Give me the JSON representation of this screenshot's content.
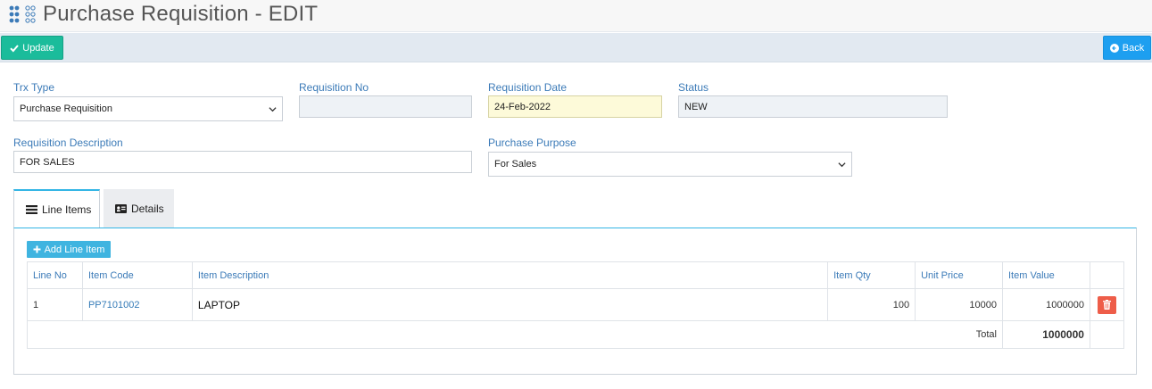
{
  "page": {
    "title": "Purchase Requisition - EDIT"
  },
  "toolbar": {
    "update_label": "Update",
    "back_label": "Back"
  },
  "form": {
    "trx_type": {
      "label": "Trx Type",
      "value": "Purchase Requisition"
    },
    "requisition_no": {
      "label": "Requisition No",
      "value": ""
    },
    "requisition_date": {
      "label": "Requisition Date",
      "value": "24-Feb-2022"
    },
    "status": {
      "label": "Status",
      "value": "NEW"
    },
    "requisition_description": {
      "label": "Requisition Description",
      "value": "FOR SALES"
    },
    "purchase_purpose": {
      "label": "Purchase Purpose",
      "value": "For Sales"
    }
  },
  "tabs": [
    {
      "label": "Line Items",
      "active": true
    },
    {
      "label": "Details",
      "active": false
    }
  ],
  "line_items": {
    "add_label": "Add Line Item",
    "columns": [
      "Line No",
      "Item Code",
      "Item Description",
      "Item Qty",
      "Unit Price",
      "Item Value"
    ],
    "rows": [
      {
        "line_no": "1",
        "item_code": "PP7101002",
        "item_description": "LAPTOP",
        "item_qty": "100",
        "unit_price": "10000",
        "item_value": "1000000"
      }
    ],
    "total_label": "Total",
    "total_value": "1000000"
  },
  "colors": {
    "accent_green": "#1bbc9b",
    "accent_blue": "#1d9ff0",
    "label_blue": "#3c7bb8",
    "delete_red": "#ee5d49"
  }
}
